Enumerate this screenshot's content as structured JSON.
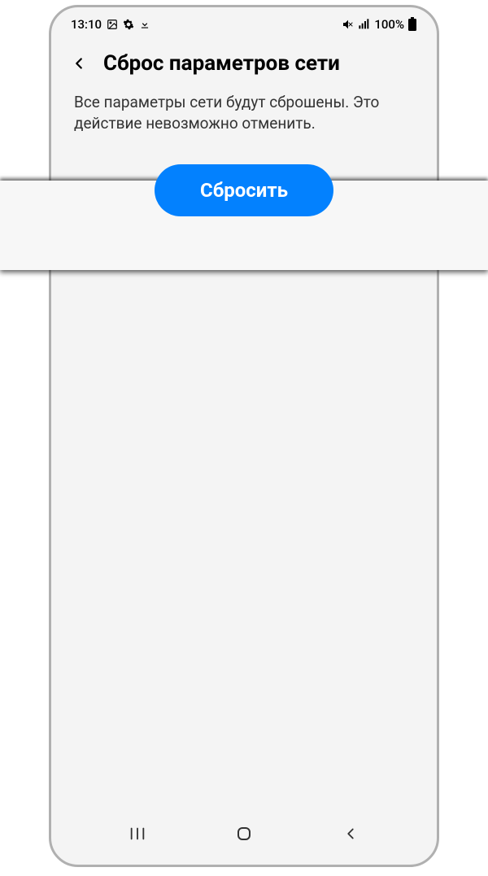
{
  "status_bar": {
    "time": "13:10",
    "battery_text": "100%",
    "icons": {
      "image": "image-icon",
      "gear": "gear-icon",
      "download": "download-icon",
      "mute": "volume-mute-icon",
      "signal": "signal-icon",
      "battery": "battery-icon"
    }
  },
  "header": {
    "title": "Сброс параметров сети"
  },
  "main": {
    "description": "Все параметры сети будут сброшены. Это действие невозможно отменить.",
    "reset_button_label": "Сбросить"
  },
  "nav": {
    "recent": "recent-apps-icon",
    "home": "home-icon",
    "back": "back-icon"
  },
  "colors": {
    "accent": "#0381fe",
    "text": "#000",
    "background": "#f4f4f4"
  }
}
